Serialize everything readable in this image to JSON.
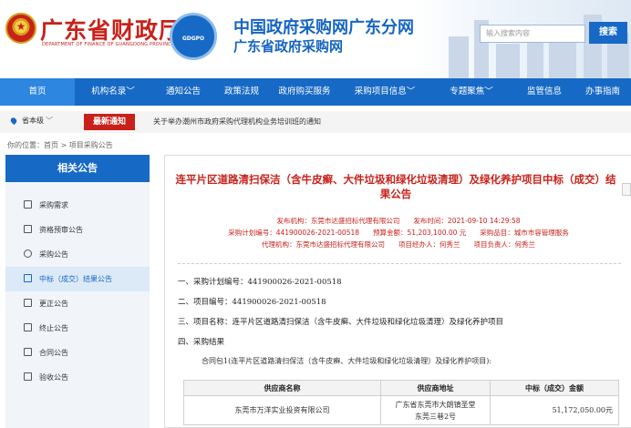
{
  "header": {
    "mof_title": "广东省财政厅",
    "mof_subtitle": "DEPARTMENT OF FINANCE OF GUANGDONG PROVINCE",
    "logo_text": "GDGPO",
    "site_title": "中国政府采购网广东分网",
    "site_subtitle": "广东省政府采购网",
    "search_placeholder": "输入搜索内容",
    "search_button": "搜索"
  },
  "nav": [
    {
      "label": "首页",
      "active": true
    },
    {
      "label": "机构名录﹀",
      "active": false
    },
    {
      "label": "通知公告",
      "active": false
    },
    {
      "label": "政策法规",
      "active": false
    },
    {
      "label": "政府购买服务",
      "active": false
    },
    {
      "label": "采购项目信息﹀",
      "active": false
    },
    {
      "label": "专题聚焦﹀",
      "active": false
    },
    {
      "label": "监管信息",
      "active": false
    },
    {
      "label": "办事指南",
      "active": false
    }
  ],
  "notice_bar": {
    "location": "省本级",
    "flash_label": "最新通知",
    "text": "关于举办潮州市政府采购代理机构业务培训班的通知"
  },
  "breadcrumb": "你的位置：首页 > 项目采购公告",
  "sidebar": {
    "heading": "相关公告",
    "items": [
      {
        "label": "采购需求",
        "icon": "document-icon",
        "active": false
      },
      {
        "label": "资格预审公告",
        "icon": "flow-icon",
        "active": false
      },
      {
        "label": "采购公告",
        "icon": "gear-icon",
        "active": false
      },
      {
        "label": "中标（成交）结果公告",
        "icon": "list-icon",
        "active": true
      },
      {
        "label": "更正公告",
        "icon": "document-icon",
        "active": false
      },
      {
        "label": "终止公告",
        "icon": "document-icon",
        "active": false
      },
      {
        "label": "合同公告",
        "icon": "document-icon",
        "active": false
      },
      {
        "label": "验收公告",
        "icon": "document-icon",
        "active": false
      }
    ]
  },
  "document": {
    "title": "连平片区道路清扫保洁（含牛皮癣、大件垃圾和绿化垃圾清理）及绿化养护项目中标（成交）结果公告",
    "meta_line1": "发布机构：东莞市达盛招标代理有限公司　　发布时间：2021-09-10 14:29:58",
    "meta_line2": "采购计划编号：441900026-2021-00518　　预算金额：51,203,100.00 元　　采购品目：城市市容管理服务",
    "meta_line3": "代理机构：东莞市达盛招标代理有限公司　　项目经办人：何秀兰　　项目负责人：何秀兰",
    "sections": [
      "一、采购计划编号：441900026-2021-00518",
      "二、项目编号：441900026-2021-00518",
      "三、项目名称：连平片区道路清扫保洁（含牛皮癣、大件垃圾和绿化垃圾清理）及绿化养护项目",
      "四、采购结果"
    ],
    "package_line": "合同包1(连平片区道路清扫保洁（含牛皮癣、大件垃圾和绿化垃圾清理）及绿化养护项目):",
    "table": {
      "headers": [
        "供应商名称",
        "供应商地址",
        "中标（成交）金额"
      ],
      "rows": [
        {
          "name": "东莞市万洋实业投资有限公司",
          "addr1": "广东省东莞市大朗镇圣堂",
          "addr2": "东莞三巷2号",
          "amount": "51,172,050.00元"
        }
      ]
    }
  }
}
